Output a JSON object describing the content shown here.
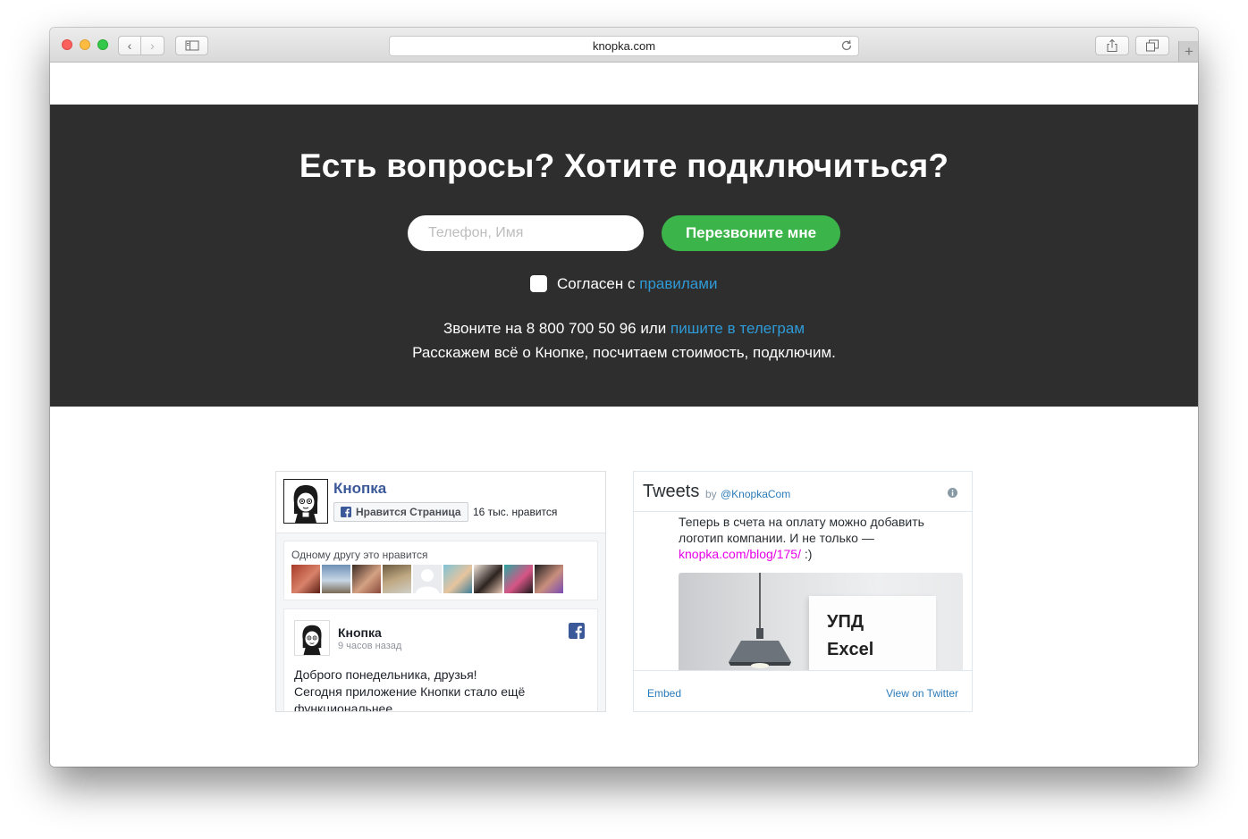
{
  "browser": {
    "url": "knopka.com",
    "back_glyph": "‹",
    "forward_glyph": "›",
    "new_tab_glyph": "+"
  },
  "cta": {
    "headline": "Есть вопросы? Хотите подключиться?",
    "phone_placeholder": "Телефон, Имя",
    "callback_label": "Перезвоните мне",
    "agree_prefix": "Согласен с ",
    "agree_link": "правилами",
    "contact_prefix": "Звоните на 8 800 700 50 96 или ",
    "contact_link": "пишите в телеграм",
    "contact_line2": "Расскажем всё о Кнопке, посчитаем стоимость, подключим."
  },
  "facebook": {
    "page_name": "Кнопка",
    "like_label": "Нравится Страница",
    "likes_count": "16 тыс. нравится",
    "friends_text": "Одному другу это нравится",
    "post_author": "Кнопка",
    "post_time": "9 часов назад",
    "post_line1": "Доброго понедельника, друзья!",
    "post_line2": "Сегодня приложение Кнопки стало ещё",
    "post_line3": "функциональнее."
  },
  "twitter": {
    "title": "Tweets",
    "by": "by",
    "handle": "@KnopkaCom",
    "tweet_text": "Теперь в счета на оплату можно добавить логотип компании. И не только — ",
    "tweet_link": "knopka.com/blog/175/",
    "tweet_suffix": " :)",
    "media_line1": "УПД",
    "media_line2": "Excel",
    "embed_label": "Embed",
    "view_label": "View on Twitter"
  },
  "colors": {
    "dark_band": "#2e2e2e",
    "accent_green": "#3bb54a",
    "link_blue": "#2e9ad7",
    "facebook_blue": "#3b5998",
    "twitter_blue": "#2b7bb9",
    "tweet_link": "#e600e6"
  },
  "icons": [
    "back-icon",
    "forward-icon",
    "sidebar-icon",
    "reload-icon",
    "share-icon",
    "tabs-icon",
    "facebook-icon",
    "info-icon"
  ]
}
